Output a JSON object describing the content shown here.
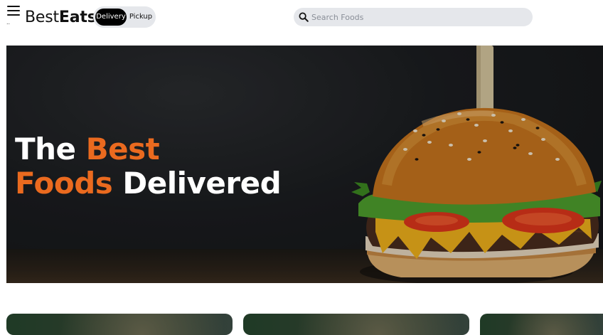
{
  "header": {
    "logo_part1": "Best",
    "logo_part2": "Eats",
    "menu_tick": "..",
    "toggle": {
      "options": [
        "Delivery",
        "Pickup"
      ],
      "selected": "Delivery"
    },
    "search": {
      "placeholder": "Search Foods",
      "value": ""
    }
  },
  "hero": {
    "line1_white": "The",
    "line1_accent": "Best",
    "line2_accent": "Foods",
    "line2_white": "Delivered",
    "accent_color": "#ea6a1f",
    "image": "burger-photo"
  },
  "cards": [
    {
      "image": "food-card-image"
    },
    {
      "image": "food-card-image"
    },
    {
      "image": "food-card-image"
    }
  ]
}
